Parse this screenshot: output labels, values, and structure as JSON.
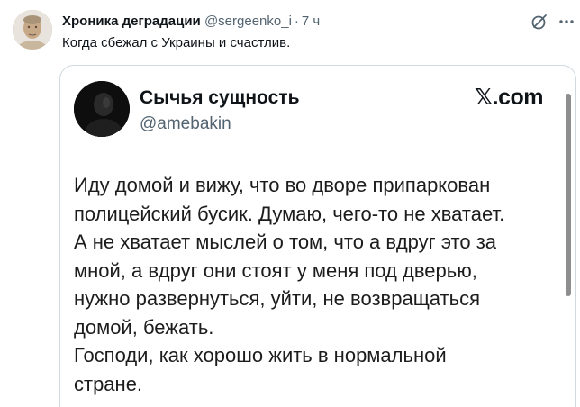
{
  "post": {
    "author_name": "Хроника деградации",
    "handle": "@sergeenko_i",
    "separator": "·",
    "time": "7 ч",
    "text": "Когда сбежал с Украины и счастлив."
  },
  "icons": {
    "grok": "grok-icon",
    "more": "more-icon"
  },
  "embed": {
    "name": "Сычья сущность",
    "handle": "@amebakin",
    "brand_mark": "𝕏",
    "brand_suffix": ".com",
    "lines": [
      "Иду домой и вижу, что во дворе припаркован",
      "полицейский бусик. Думаю, чего-то не хватает.",
      "А не хватает мыслей о том, что а вдруг это за",
      "мной, а вдруг они стоят у меня под дверью,",
      "нужно развернуться, уйти, не возвращаться",
      "домой, бежать.",
      "Господи, как хорошо жить в нормальной",
      "стране."
    ]
  },
  "colors": {
    "text": "#0f1419",
    "secondary": "#536471",
    "border": "#cfd9de"
  }
}
